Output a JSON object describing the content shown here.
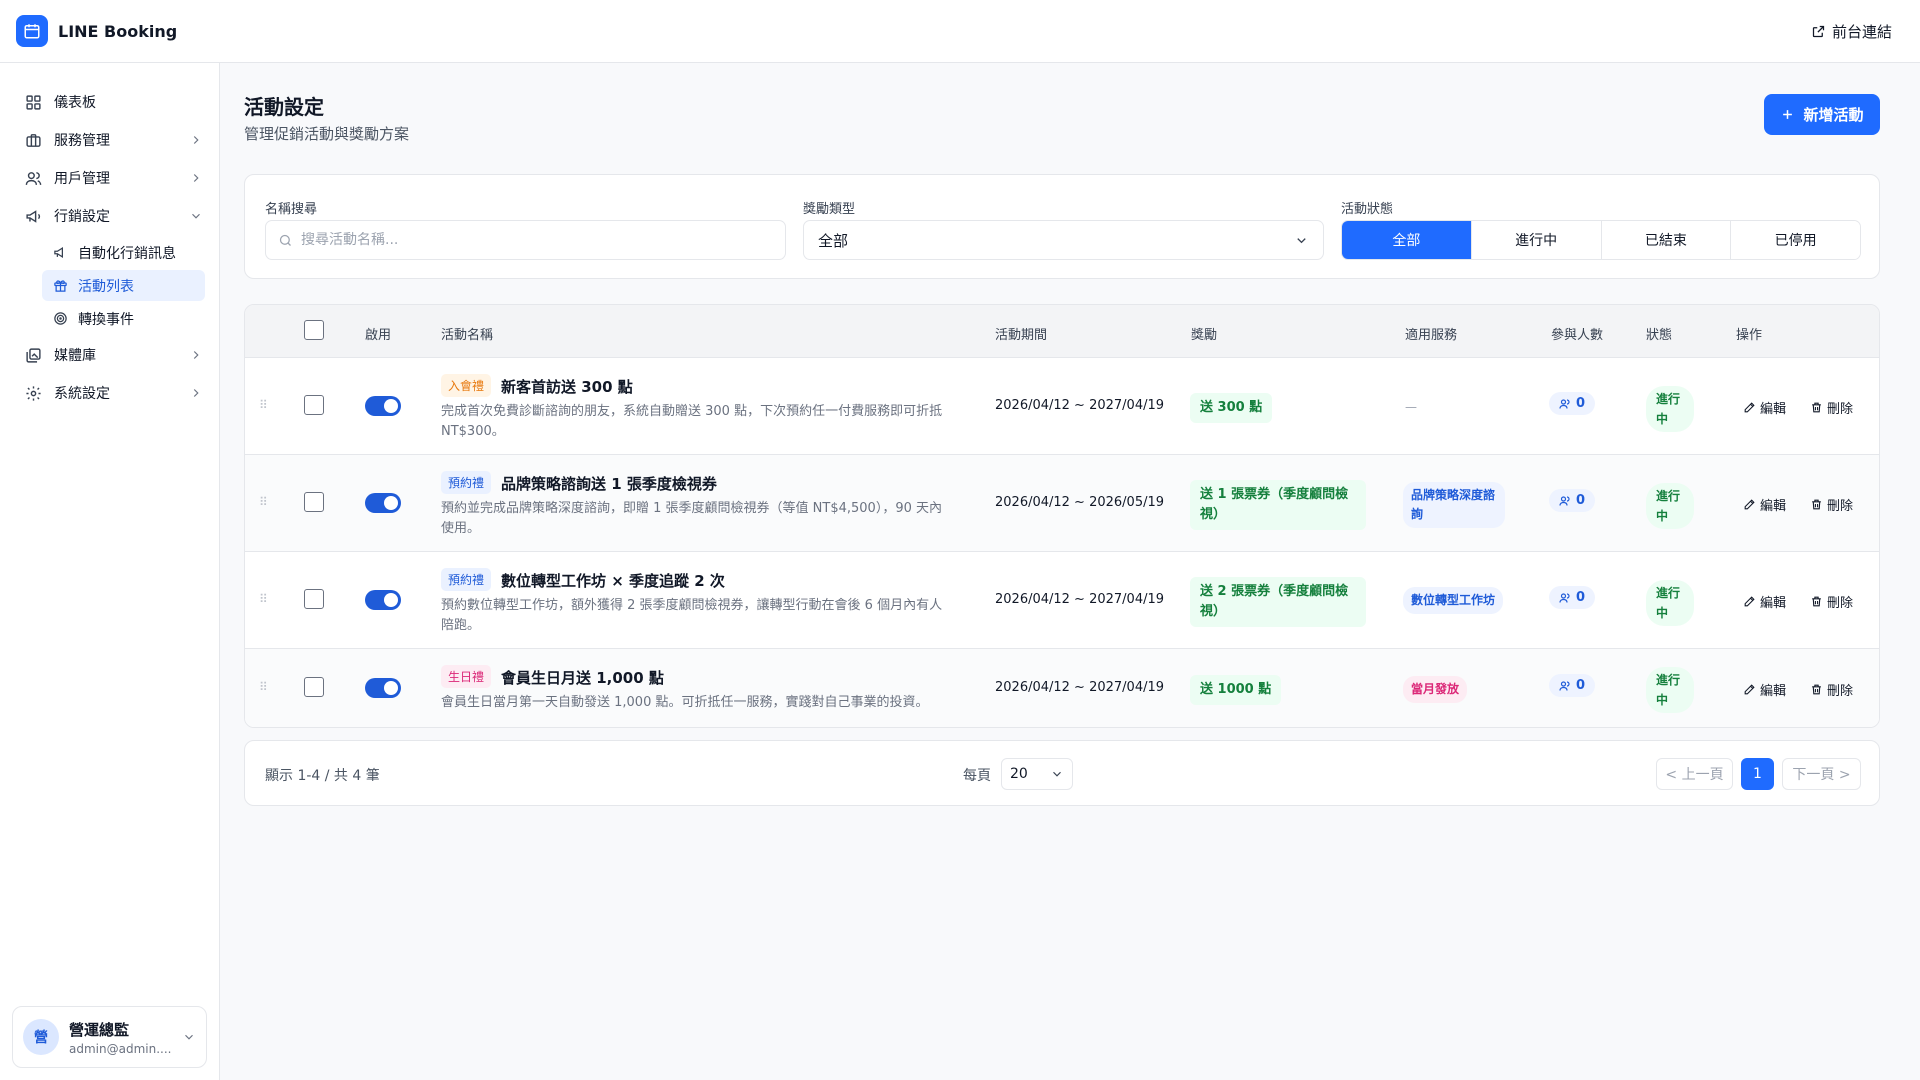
{
  "app": {
    "brand": "LINE Booking",
    "front_link": "前台連結"
  },
  "sidebar": {
    "items": [
      {
        "label": "儀表板"
      },
      {
        "label": "服務管理"
      },
      {
        "label": "用戶管理"
      },
      {
        "label": "行銷設定"
      },
      {
        "label": "媒體庫"
      },
      {
        "label": "系統設定"
      }
    ],
    "sub_items": [
      {
        "label": "自動化行銷訊息"
      },
      {
        "label": "活動列表"
      },
      {
        "label": "轉換事件"
      }
    ],
    "user": {
      "avatar": "營",
      "name": "營運總監",
      "email": "admin@admin...."
    }
  },
  "page": {
    "title": "活動設定",
    "subtitle": "管理促銷活動與獎勵方案",
    "add_button": "新增活動"
  },
  "filters": {
    "name_label": "名稱搜尋",
    "name_placeholder": "搜尋活動名稱...",
    "type_label": "獎勵類型",
    "type_value": "全部",
    "status_label": "活動狀態",
    "status_options": [
      "全部",
      "進行中",
      "已結束",
      "已停用"
    ]
  },
  "table": {
    "columns": [
      "啟用",
      "活動名稱",
      "活動期間",
      "獎勵",
      "適用服務",
      "參與人數",
      "狀態",
      "操作"
    ],
    "rows": [
      {
        "tag": "入會禮",
        "name": "新客首訪送 300 點",
        "desc": "完成首次免費診斷諮詢的朋友，系統自動贈送 300 點，下次預約任一付費服務即可折抵 NT$300。",
        "period": "2026/04/12 ~ 2027/04/19",
        "reward": "送 300 點",
        "service": "—",
        "participants": "0",
        "status": "進行中",
        "edit": "編輯",
        "delete": "刪除"
      },
      {
        "tag": "預約禮",
        "name": "品牌策略諮詢送 1 張季度檢視券",
        "desc": "預約並完成品牌策略深度諮詢，即贈 1 張季度顧問檢視券（等值 NT$4,500），90 天內使用。",
        "period": "2026/04/12 ~ 2026/05/19",
        "reward": "送 1 張票券（季度顧問檢視）",
        "service": "品牌策略深度諮詢",
        "participants": "0",
        "status": "進行中",
        "edit": "編輯",
        "delete": "刪除"
      },
      {
        "tag": "預約禮",
        "name": "數位轉型工作坊 × 季度追蹤 2 次",
        "desc": "預約數位轉型工作坊，額外獲得 2 張季度顧問檢視券，讓轉型行動在會後 6 個月內有人陪跑。",
        "period": "2026/04/12 ~ 2027/04/19",
        "reward": "送 2 張票券（季度顧問檢視）",
        "service": "數位轉型工作坊",
        "participants": "0",
        "status": "進行中",
        "edit": "編輯",
        "delete": "刪除"
      },
      {
        "tag": "生日禮",
        "name": "會員生日月送 1,000 點",
        "desc": "會員生日當月第一天自動發送 1,000 點。可折抵任一服務，實踐對自己事業的投資。",
        "period": "2026/04/12 ~ 2027/04/19",
        "reward": "送 1000 點",
        "service": "當月發放",
        "participants": "0",
        "status": "進行中",
        "edit": "編輯",
        "delete": "刪除"
      }
    ]
  },
  "pagination": {
    "info": "顯示 1-4 / 共 4 筆",
    "per_label": "每頁",
    "per_value": "20",
    "prev": "< 上一頁",
    "current": "1",
    "next": "下一頁 >"
  },
  "colors": {
    "primary": "#1f6bff",
    "tag_join_bg": "#fff4e5",
    "tag_join_fg": "#e8790e",
    "tag_booking_bg": "#eaf1ff",
    "tag_booking_fg": "#1f5bd8",
    "tag_birthday_bg": "#fdecf3",
    "tag_birthday_fg": "#db2777"
  }
}
